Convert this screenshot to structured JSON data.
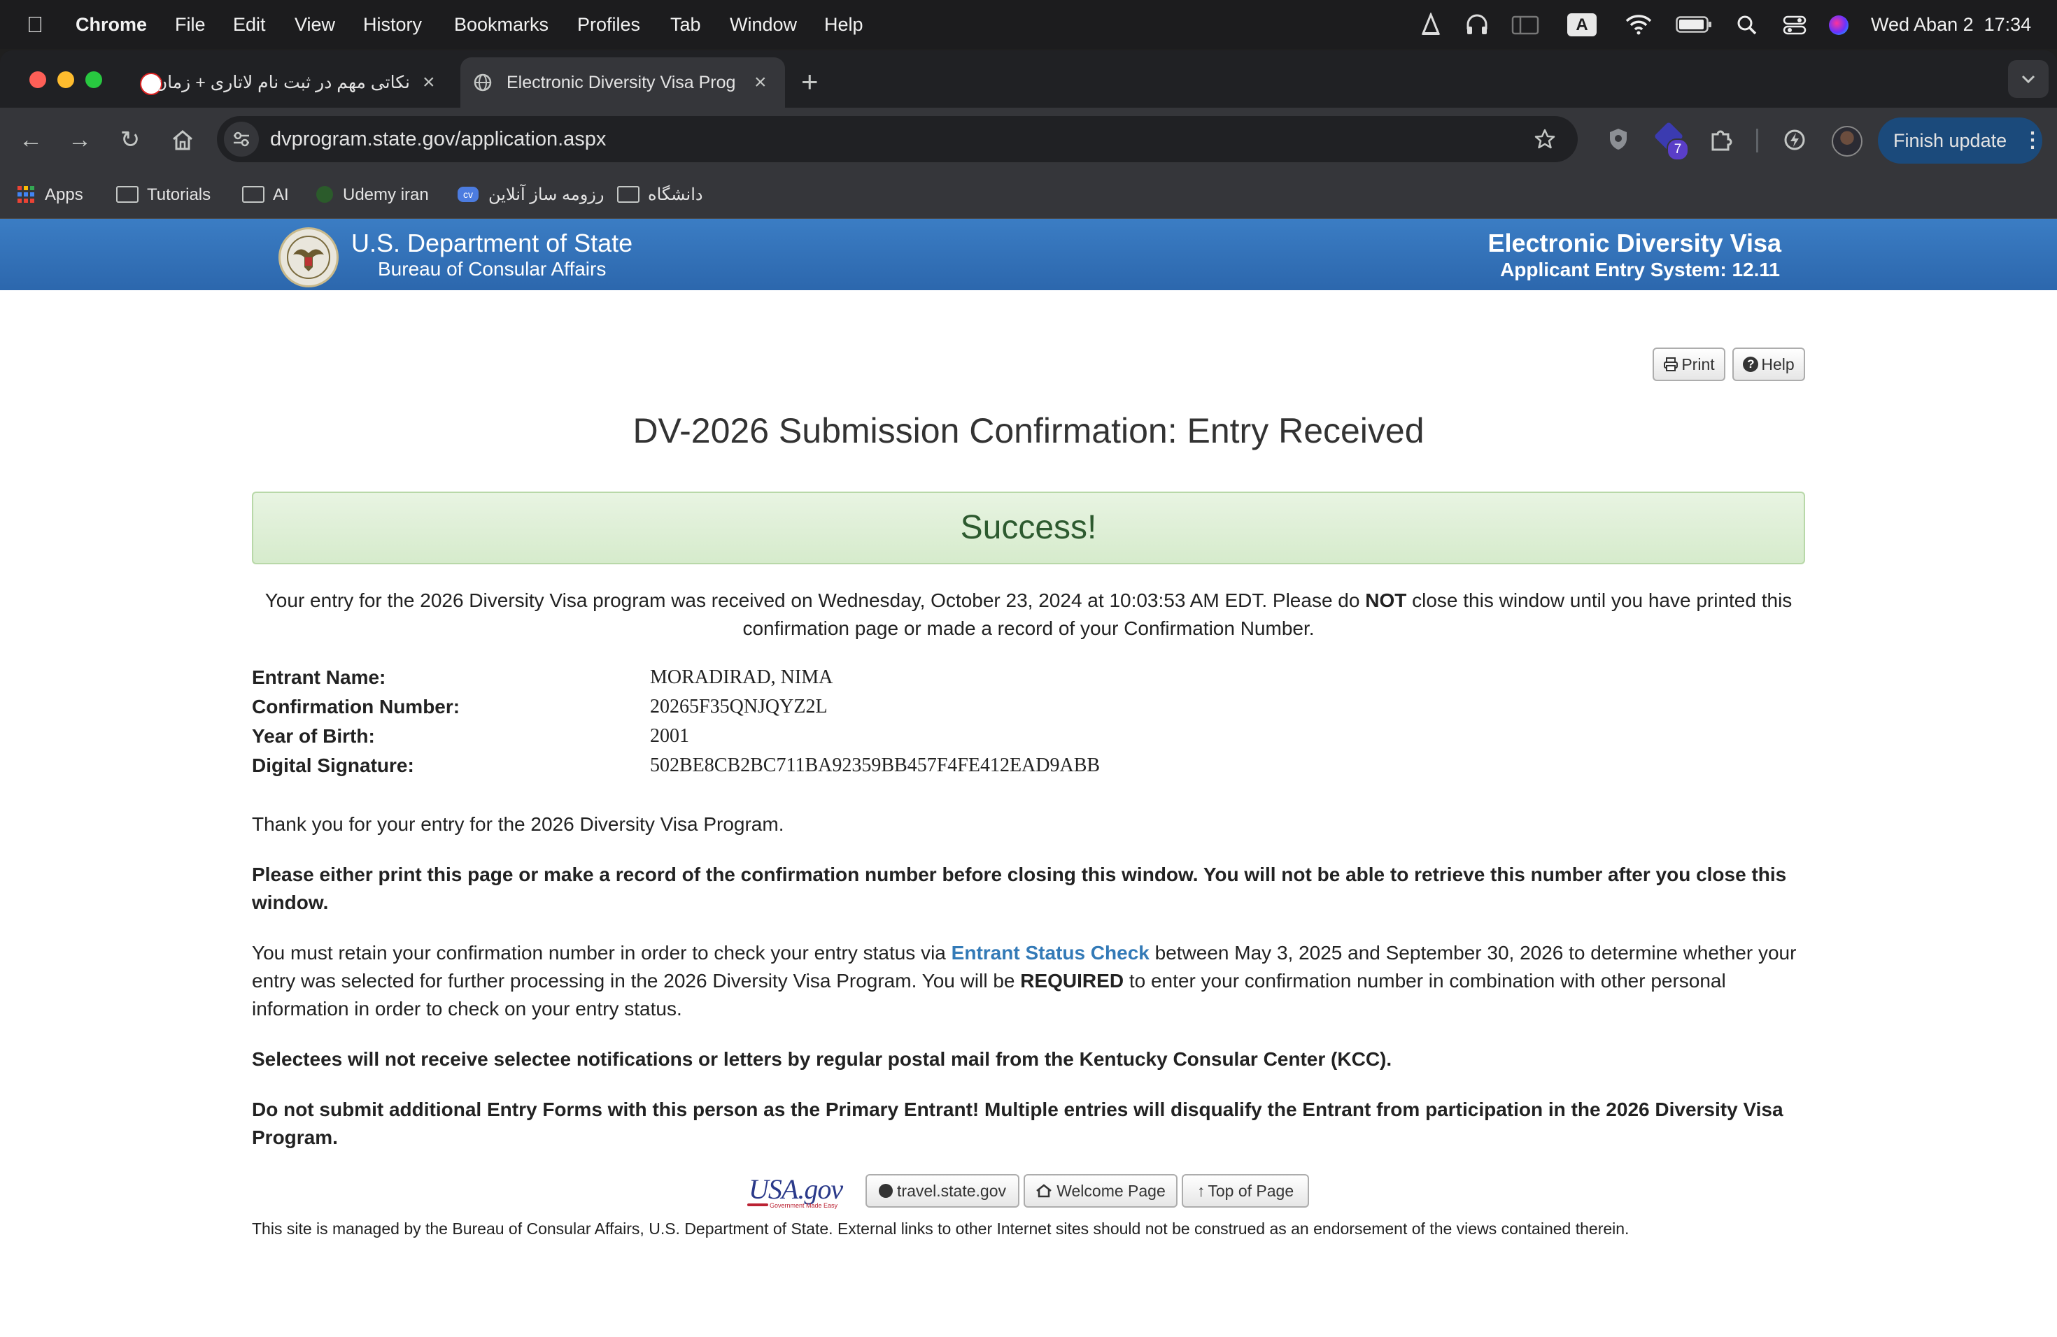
{
  "menubar": {
    "app": "Chrome",
    "items": [
      "File",
      "Edit",
      "View",
      "History",
      "Bookmarks",
      "Profiles",
      "Tab",
      "Window",
      "Help"
    ],
    "input_indicator": "A",
    "clock": "Wed Aban 2  17:34"
  },
  "tabs": [
    {
      "title": "نکاتی مهم در ثبت نام لاتاری + زمان",
      "active": false
    },
    {
      "title": "Electronic Diversity Visa Prog",
      "active": true
    }
  ],
  "new_tab": "+",
  "toolbar": {
    "url": "dvprogram.state.gov/application.aspx",
    "extension_badge": "7",
    "finish_update": "Finish update"
  },
  "bookmarks": [
    "Apps",
    "Tutorials",
    "AI",
    "Udemy iran",
    "رزومه ساز آنلاین",
    "دانشگاه"
  ],
  "site_header": {
    "dept": "U.S. Department of State",
    "bureau": "Bureau of Consular Affairs",
    "system": "Electronic Diversity Visa",
    "version": "Applicant Entry System: 12.11"
  },
  "buttons": {
    "print": "Print",
    "help": "Help"
  },
  "page_title": "DV-2026 Submission Confirmation: Entry Received",
  "success": "Success!",
  "intro": {
    "pre": "Your entry for the 2026 Diversity Visa program was received on Wednesday, October 23, 2024 at 10:03:53 AM EDT. Please do ",
    "strong": "NOT",
    "post": " close this window until you have printed this confirmation page or made a record of your Confirmation Number."
  },
  "details": [
    {
      "label": "Entrant Name:",
      "value": "MORADIRAD, NIMA"
    },
    {
      "label": "Confirmation Number:",
      "value": "20265F35QNJQYZ2L"
    },
    {
      "label": "Year of Birth:",
      "value": "2001"
    },
    {
      "label": "Digital Signature:",
      "value": "502BE8CB2BC711BA92359BB457F4FE412EAD9ABB"
    }
  ],
  "thanks": "Thank you for your entry for the 2026 Diversity Visa Program.",
  "warn_print": "Please either print this page or make a record of the confirmation number before closing this window. You will not be able to retrieve this number after you close this window.",
  "retain": {
    "pre": "You must retain your confirmation number in order to check your entry status via ",
    "link": "Entrant Status Check",
    "mid": " between May 3, 2025 and September 30, 2026 to determine whether your entry was selected for further processing in the 2026 Diversity Visa Program. You will be ",
    "strong": "REQUIRED",
    "post": " to enter your confirmation number in combination with other personal information in order to check on your entry status."
  },
  "selectees": "Selectees will not receive selectee notifications or letters by regular postal mail from the Kentucky Consular Center (KCC).",
  "do_not_submit": "Do not submit additional Entry Forms with this person as the Primary Entrant! Multiple entries will disqualify the Entrant from participation in the 2026 Diversity Visa Program.",
  "footer_logo": {
    "main": "USA.gov",
    "tagline": "Government Made Easy"
  },
  "footer_buttons": [
    "travel.state.gov",
    "Welcome Page",
    "Top of Page"
  ],
  "disclaimer": "This site is managed by the Bureau of Consular Affairs, U.S. Department of State. External links to other Internet sites should not be construed as an endorsement of the views contained therein.",
  "colors": {
    "brand_blue": "#2f6fb7",
    "success_bg": "#dff0d8",
    "success_text": "#2d6a2f",
    "link": "#337ab7"
  }
}
